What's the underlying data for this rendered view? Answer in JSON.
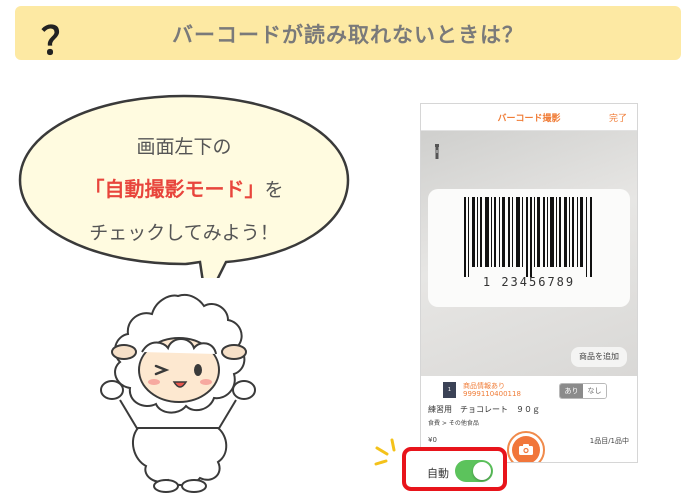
{
  "banner": {
    "question_mark": "？",
    "title": "バーコードが読み取れないときは？"
  },
  "bubble": {
    "line1": "画面左下の",
    "line2_highlight": "「自動撮影モード」",
    "line2_suffix": "を",
    "line3": "チェックしてみよう！"
  },
  "phone": {
    "nav_title": "バーコード撮影",
    "nav_done": "完了",
    "barcode_number": "1 23456789",
    "add_button": "商品を追加",
    "item": {
      "thumb_label": "1",
      "tag": "商品情報あり",
      "code": "9999110400118",
      "toggle_on": "あり",
      "toggle_off": "なし",
      "name": "練習用　チョコレート　９０ｇ",
      "category": "食費 > その他食品",
      "price": "¥0",
      "count": "1品目/1品中"
    }
  },
  "auto": {
    "label": "自動",
    "enabled": true
  },
  "colors": {
    "banner_bg": "#fde9a3",
    "accent_orange": "#f07d38",
    "highlight_red": "#e8453c",
    "switch_green": "#5cc35c"
  }
}
